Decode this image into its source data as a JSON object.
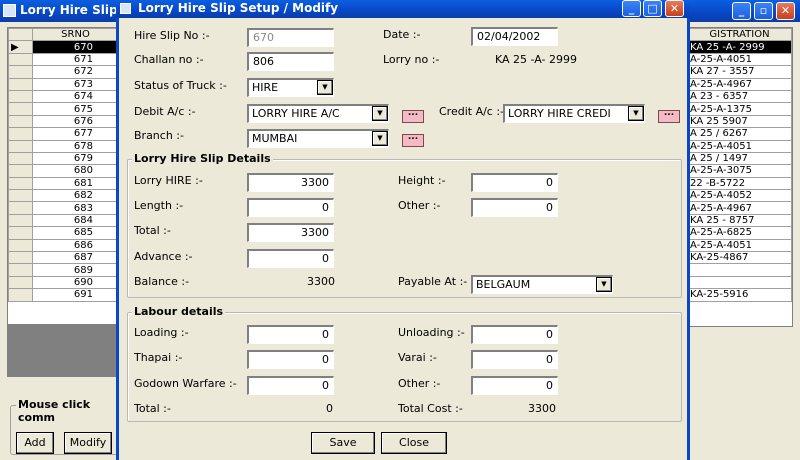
{
  "main_window": {
    "title": "Lorry Hire Slip",
    "left_grid": {
      "header": "SRNO",
      "rows": [
        "670",
        "671",
        "672",
        "673",
        "674",
        "675",
        "676",
        "677",
        "678",
        "679",
        "680",
        "681",
        "682",
        "683",
        "684",
        "685",
        "686",
        "687",
        "689",
        "690",
        "691"
      ],
      "selected_index": 0
    },
    "right_grid": {
      "header": "GISTRATION",
      "rows": [
        "KA 25 -A- 2999",
        "A-25-A-4051",
        "KA 27 - 3557",
        "A-25-A-4967",
        "A 23 - 6357",
        "A-25-A-1375",
        "KA 25 5907",
        "A 25 / 6267",
        "A-25-A-4051",
        "A 25 / 1497",
        "A-25-A-3075",
        "22 -B-5722",
        "A-25-A-4052",
        "A-25-A-4967",
        "KA 25 - 8757",
        "A-25-A-6825",
        "A-25-A-4051",
        "KA-25-4867",
        "",
        "",
        "KA-25-5916"
      ],
      "selected_index": 0
    },
    "mouse_group_title": "Mouse click comm",
    "add_label": "Add",
    "modify_label": "Modify"
  },
  "dialog": {
    "title": "Lorry Hire Slip Setup / Modify",
    "hire_slip_no_label": "Hire Slip No :-",
    "hire_slip_no": "670",
    "date_label": "Date :-",
    "date": "02/04/2002",
    "challan_no_label": "Challan no :-",
    "challan_no": "806",
    "lorry_no_label": "Lorry no :-",
    "lorry_no": "KA 25 -A- 2999",
    "status_label": "Status of Truck :-",
    "status": "HIRE",
    "debit_label": "Debit A/c :-",
    "debit": "LORRY HIRE A/C",
    "credit_label": "Credit A/c :-",
    "credit": "LORRY HIRE  CREDI",
    "branch_label": "Branch :-",
    "branch": "MUMBAI",
    "dots": "...",
    "hire_details": {
      "title": "Lorry Hire Slip Details",
      "lorry_hire_label": "Lorry HIRE :-",
      "lorry_hire": "3300",
      "height_label": "Height :-",
      "height": "0",
      "length_label": "Length :-",
      "length": "0",
      "other_label": "Other :-",
      "other": "0",
      "total_label": "Total :-",
      "total": "3300",
      "advance_label": "Advance :-",
      "advance": "0",
      "balance_label": "Balance :-",
      "balance": "3300",
      "payable_label": "Payable At :-",
      "payable": "BELGAUM"
    },
    "labour": {
      "title": "Labour details",
      "loading_label": "Loading :-",
      "loading": "0",
      "unloading_label": "Unloading :-",
      "unloading": "0",
      "thapai_label": "Thapai :-",
      "thapai": "0",
      "varai_label": "Varai :-",
      "varai": "0",
      "godown_label": "Godown Warfare :-",
      "godown": "0",
      "other_label": "Other :-",
      "other": "0",
      "total_label": "Total :-",
      "total": "0",
      "total_cost_label": "Total Cost :-",
      "total_cost": "3300"
    },
    "save_label": "Save",
    "close_label": "Close"
  }
}
